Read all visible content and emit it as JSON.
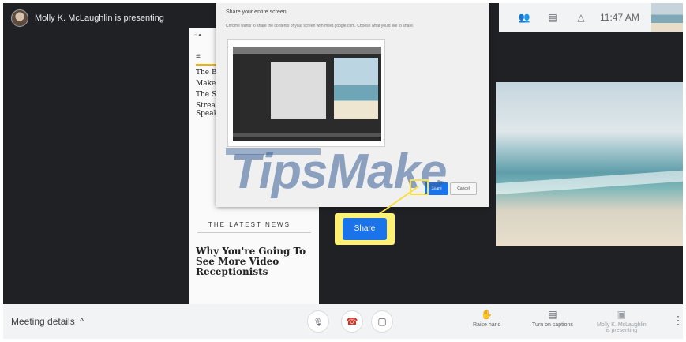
{
  "presenter_chip": {
    "label": "Molly K. McLaughlin is presenting"
  },
  "topbar": {
    "people_icon": "👥",
    "chat_icon": "▤",
    "activities_icon": "△",
    "time": "11:47 AM"
  },
  "webpage": {
    "menu_icon": "≡",
    "articles": [
      {
        "title": "The Be"
      },
      {
        "title": "Make I"
      },
      {
        "title": "The Sc"
      },
      {
        "title": "Stream"
      },
      {
        "title": "Speak"
      }
    ],
    "latest_heading": "THE LATEST NEWS",
    "headline": "Why You're Going To See More Video Receptionists"
  },
  "dialog": {
    "title": "Share your entire screen",
    "description": "Chrome wants to share the contents of your screen with meet.google.com. Choose what you'd like to share.",
    "share_label": "Share",
    "cancel_label": "Cancel"
  },
  "watermark": {
    "text": "TipsMake"
  },
  "callout": {
    "share_label": "Share",
    "highlight_color": "#fff176"
  },
  "bottombar": {
    "meeting_details": "Meeting details",
    "chevron": "^",
    "mic_icon": "🎙",
    "end_call_icon": "☎",
    "camera_icon": "▢",
    "raise_hand_icon": "✋",
    "raise_hand": "Raise hand",
    "captions_icon": "▤",
    "captions": "Turn on captions",
    "present_icon": "▣",
    "presenting_line1": "Molly K. McLaughlin",
    "presenting_line2": "is presenting",
    "more_icon": "⋮"
  },
  "colors": {
    "accent": "#1a73e8",
    "end_call": "#d93025",
    "background": "#202124"
  }
}
